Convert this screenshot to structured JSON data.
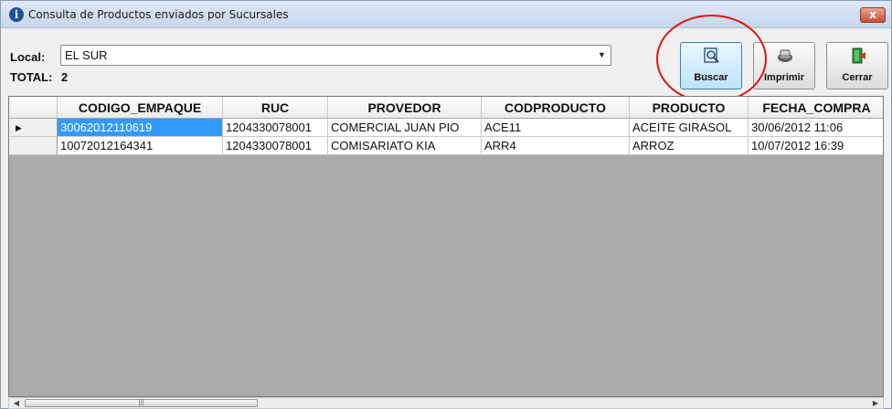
{
  "window": {
    "title": "Consulta de Productos enviados por Sucursales",
    "close_glyph": "x"
  },
  "filters": {
    "local_label": "Local:",
    "local_value": "EL SUR",
    "total_label": "TOTAL:",
    "total_value": "2"
  },
  "toolbar": {
    "buscar_label": "Buscar",
    "imprimir_label": "Imprimir",
    "cerrar_label": "Cerrar"
  },
  "table": {
    "columns": [
      "CODIGO_EMPAQUE",
      "RUC",
      "PROVEDOR",
      "CODPRODUCTO",
      "PRODUCTO",
      "FECHA_COMPRA"
    ],
    "rows": [
      [
        "30062012110619",
        "1204330078001",
        "COMERCIAL JUAN PIO",
        "ACE11",
        "ACEITE GIRASOL",
        "30/06/2012 11:06"
      ],
      [
        "10072012164341",
        "1204330078001",
        "COMISARIATO KIA",
        "ARR4",
        "ARROZ",
        "10/07/2012 16:39"
      ]
    ],
    "current_row_marker": "▶"
  },
  "icons": {
    "title": "info-icon",
    "buscar": "search-icon",
    "imprimir": "printer-icon",
    "cerrar": "exit-door-icon"
  },
  "colors": {
    "selection": "#3399ff",
    "highlight_circle": "#e01414",
    "grid_background": "#ababab"
  }
}
